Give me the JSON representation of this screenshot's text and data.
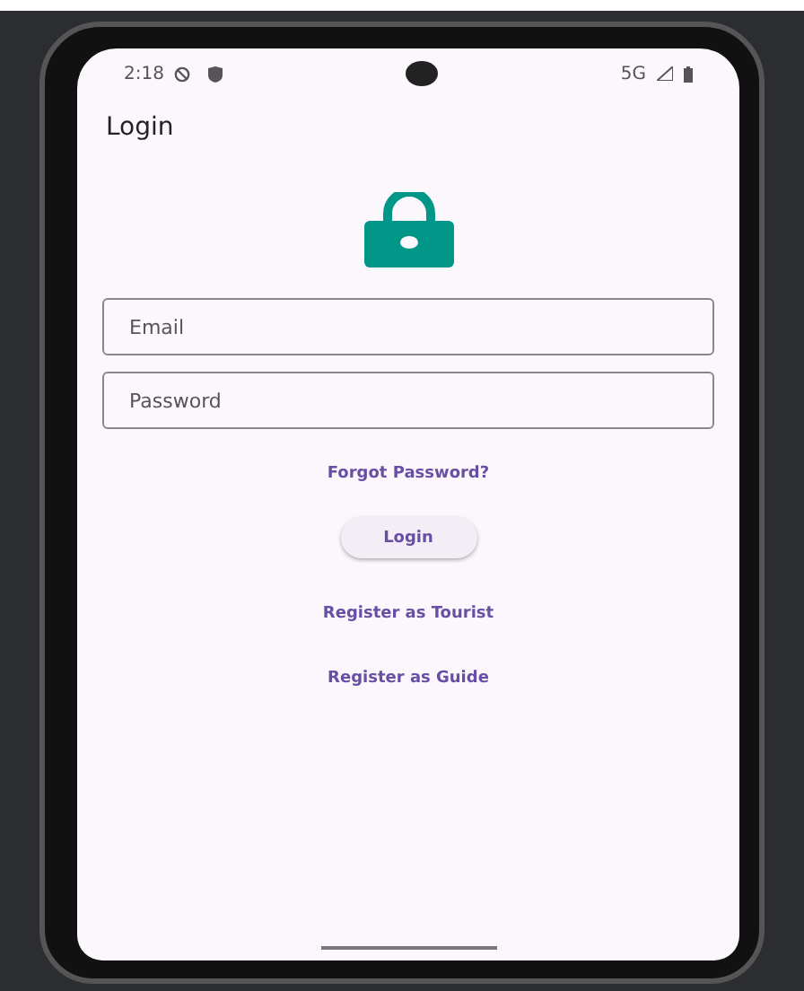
{
  "status_bar": {
    "time": "2:18",
    "network": "5G"
  },
  "app_bar": {
    "title": "Login"
  },
  "fields": [
    {
      "placeholder": "Email"
    },
    {
      "placeholder": "Password"
    }
  ],
  "forgot_link": "Forgot Password?",
  "login_button": "Login",
  "links": [
    "Register as Tourist",
    "Register as Guide"
  ]
}
